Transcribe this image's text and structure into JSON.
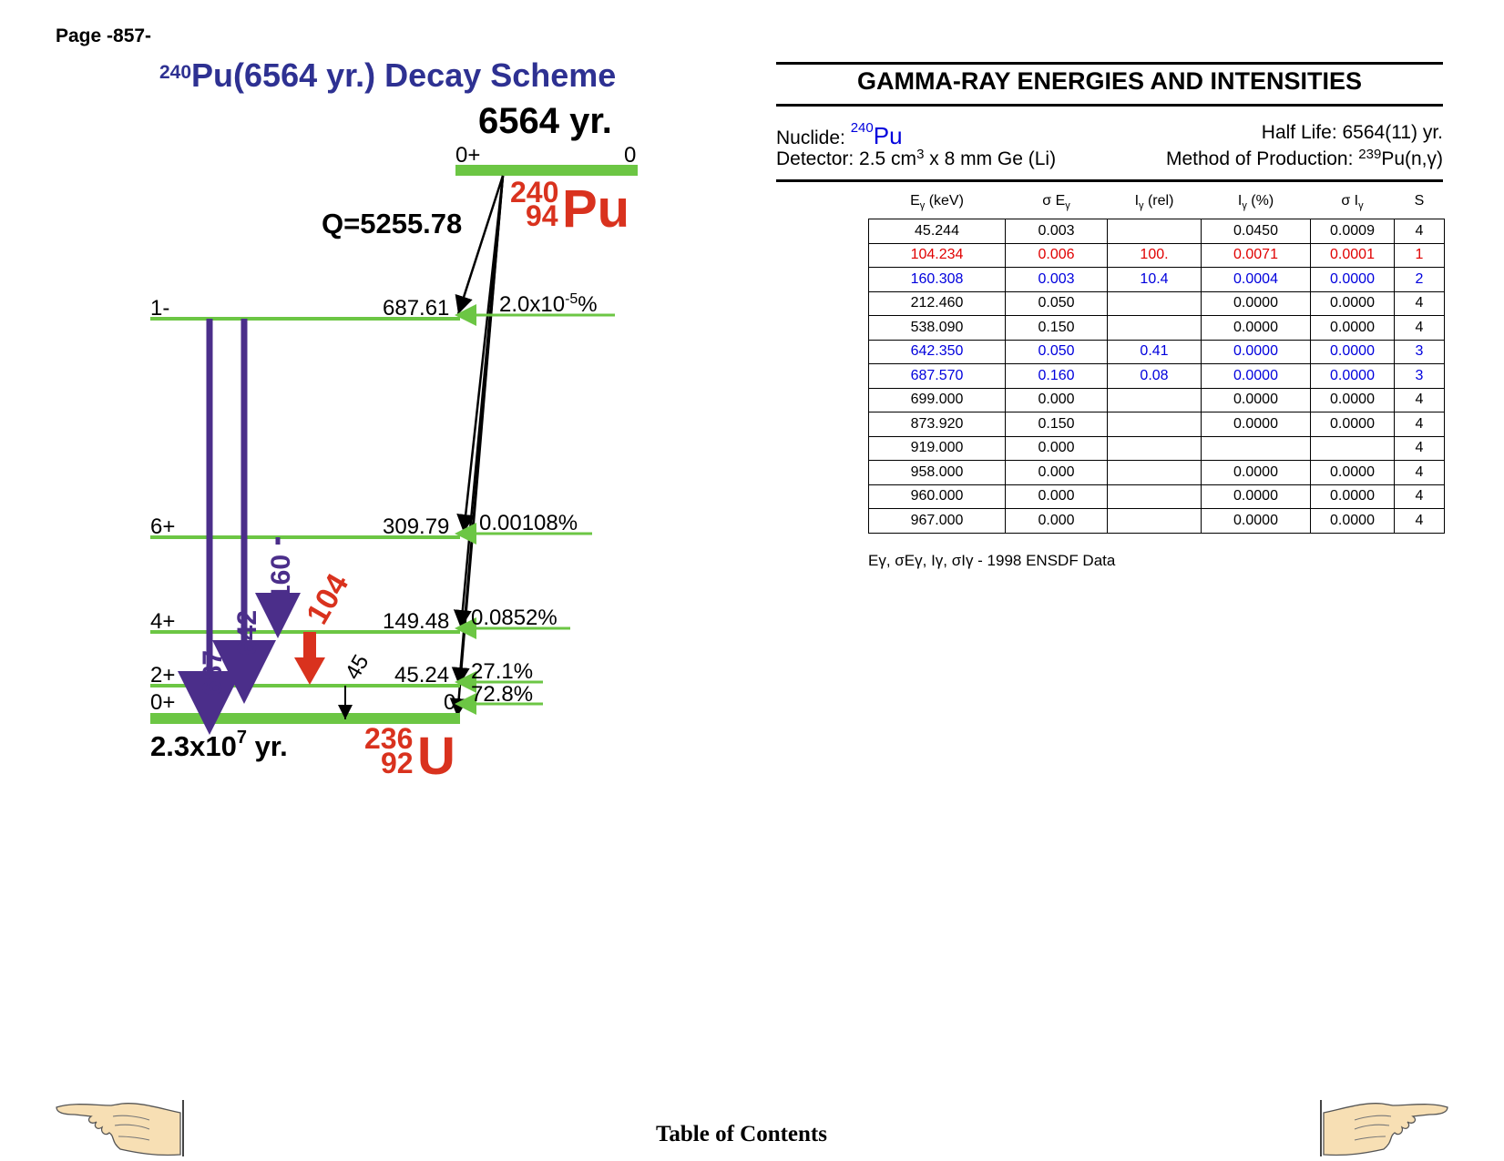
{
  "page": {
    "label": "Page -857-"
  },
  "scheme": {
    "title_mass": "240",
    "title_rest": "Pu(6564 yr.) Decay Scheme",
    "parent": {
      "half_life": "6564 yr.",
      "spin": "0+",
      "energy": "0",
      "mass": "240",
      "z": "94",
      "symbol": "Pu",
      "q_value": "Q=5255.78"
    },
    "daughter": {
      "half_life_base": "2.3x10",
      "half_life_exp": "7",
      "half_life_unit": " yr.",
      "mass": "236",
      "z": "92",
      "symbol": "U"
    },
    "levels": [
      {
        "spin": "1-",
        "energy": "687.61",
        "branch": "2.0x10",
        "branch_exp": "-5",
        "branch_unit": "%"
      },
      {
        "spin": "6+",
        "energy": "309.79",
        "branch": "0.00108%"
      },
      {
        "spin": "4+",
        "energy": "149.48",
        "branch": "0.0852%"
      },
      {
        "spin": "2+",
        "energy": "45.24",
        "branch": "27.1%"
      },
      {
        "spin": "0+",
        "energy": "0",
        "branch": "72.8%"
      }
    ],
    "gammas": [
      {
        "label": "687",
        "color": "#4b2e8a"
      },
      {
        "label": "642",
        "color": "#4b2e8a"
      },
      {
        "label": "160",
        "color": "#4b2e8a"
      },
      {
        "label": "104",
        "color": "#d9321e"
      },
      {
        "label": "45",
        "color": "#000000"
      }
    ],
    "colors": {
      "level": "#6cc644",
      "title": "#2e3192",
      "nuclide": "#d9321e"
    }
  },
  "panel": {
    "title": "GAMMA-RAY ENERGIES AND INTENSITIES",
    "nuclide_label": "Nuclide: ",
    "nuclide_mass": "240",
    "nuclide_symbol": "Pu",
    "half_life": "Half Life: 6564(11) yr.",
    "detector_a": "Detector: 2.5 cm",
    "detector_sup": "3",
    "detector_b": " x 8 mm Ge (Li)",
    "production_a": "Method of Production: ",
    "production_sup": "239",
    "production_b": "Pu(n,γ)"
  },
  "table": {
    "headers": [
      "Eγ (keV)",
      "σ Eγ",
      "Iγ (rel)",
      "Iγ (%)",
      "σ Iγ",
      "S"
    ],
    "rows": [
      {
        "color": "black",
        "cells": [
          "45.244",
          "0.003",
          "",
          "0.0450",
          "0.0009",
          "4"
        ]
      },
      {
        "color": "red",
        "cells": [
          "104.234",
          "0.006",
          "100.",
          "0.0071",
          "0.0001",
          "1"
        ]
      },
      {
        "color": "blue",
        "cells": [
          "160.308",
          "0.003",
          "10.4",
          "0.0004",
          "0.0000",
          "2"
        ]
      },
      {
        "color": "black",
        "cells": [
          "212.460",
          "0.050",
          "",
          "0.0000",
          "0.0000",
          "4"
        ]
      },
      {
        "color": "black",
        "cells": [
          "538.090",
          "0.150",
          "",
          "0.0000",
          "0.0000",
          "4"
        ]
      },
      {
        "color": "blue",
        "cells": [
          "642.350",
          "0.050",
          "0.41",
          "0.0000",
          "0.0000",
          "3"
        ]
      },
      {
        "color": "blue",
        "cells": [
          "687.570",
          "0.160",
          "0.08",
          "0.0000",
          "0.0000",
          "3"
        ]
      },
      {
        "color": "black",
        "cells": [
          "699.000",
          "0.000",
          "",
          "0.0000",
          "0.0000",
          "4"
        ]
      },
      {
        "color": "black",
        "cells": [
          "873.920",
          "0.150",
          "",
          "0.0000",
          "0.0000",
          "4"
        ]
      },
      {
        "color": "black",
        "cells": [
          "919.000",
          "0.000",
          "",
          "",
          "",
          "4"
        ]
      },
      {
        "color": "black",
        "cells": [
          "958.000",
          "0.000",
          "",
          "0.0000",
          "0.0000",
          "4"
        ]
      },
      {
        "color": "black",
        "cells": [
          "960.000",
          "0.000",
          "",
          "0.0000",
          "0.0000",
          "4"
        ]
      },
      {
        "color": "black",
        "cells": [
          "967.000",
          "0.000",
          "",
          "0.0000",
          "0.0000",
          "4"
        ]
      }
    ],
    "footnote": "Eγ, σEγ, Iγ, σIγ - 1998 ENSDF Data"
  },
  "nav": {
    "toc": "Table of Contents",
    "prev_icon": "pointing-hand-left-icon",
    "next_icon": "pointing-hand-right-icon"
  }
}
